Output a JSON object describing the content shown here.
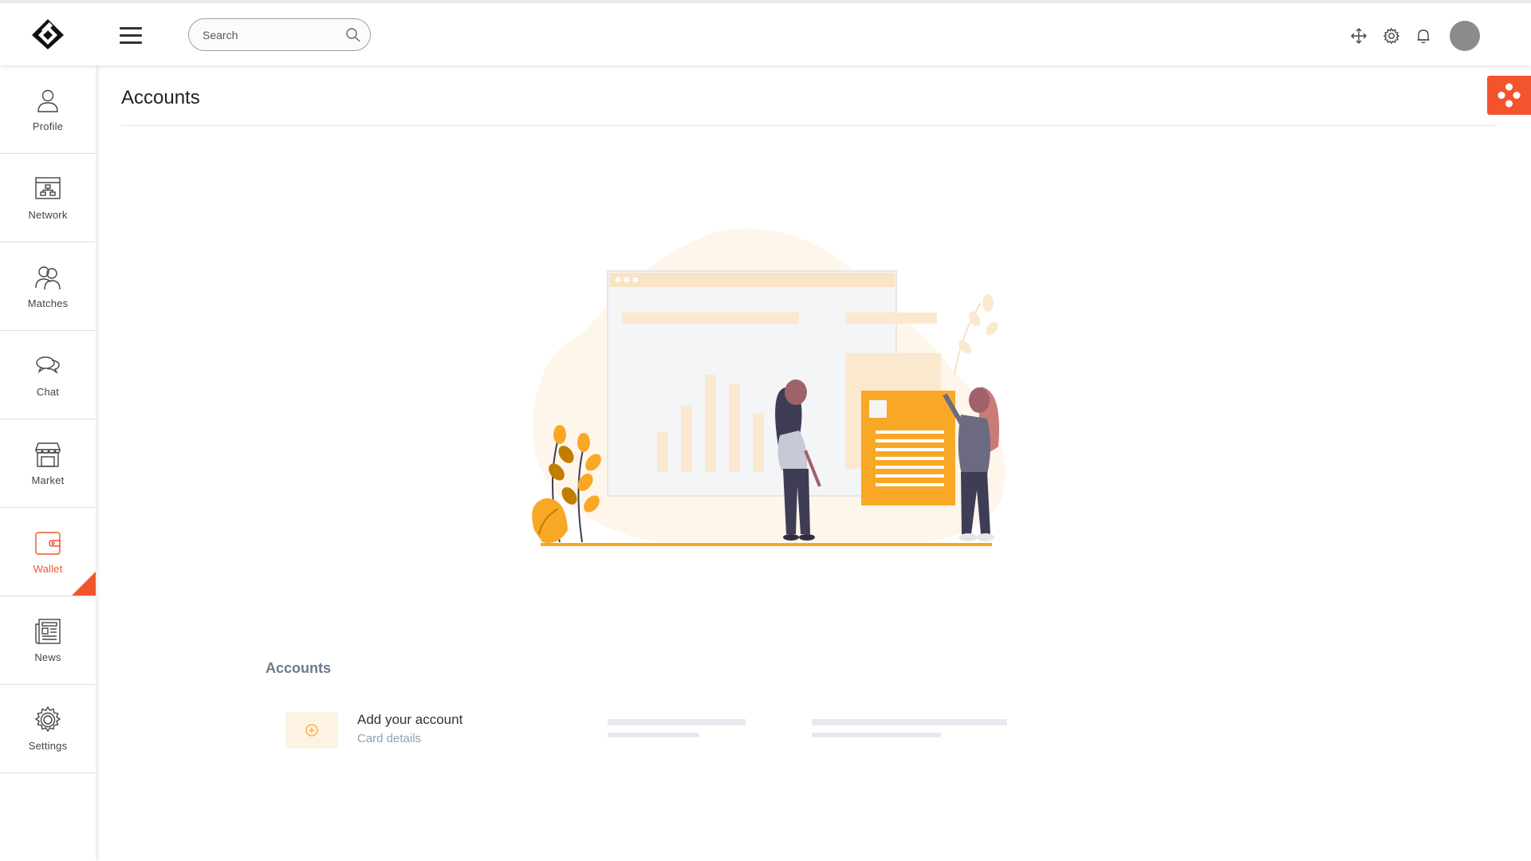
{
  "header": {
    "search": {
      "placeholder": "Search"
    }
  },
  "sidebar": {
    "items": [
      {
        "label": "Profile",
        "icon": "profile-icon"
      },
      {
        "label": "Network",
        "icon": "network-icon"
      },
      {
        "label": "Matches",
        "icon": "matches-icon"
      },
      {
        "label": "Chat",
        "icon": "chat-icon"
      },
      {
        "label": "Market",
        "icon": "market-icon"
      },
      {
        "label": "Wallet",
        "icon": "wallet-icon",
        "active": true
      },
      {
        "label": "News",
        "icon": "news-icon"
      },
      {
        "label": "Settings",
        "icon": "settings-icon"
      }
    ]
  },
  "main": {
    "title": "Accounts",
    "section_title": "Accounts",
    "add_account": {
      "title": "Add your account",
      "subtitle": "Card details"
    }
  },
  "colors": {
    "accent": "#f2542d",
    "illustration_orange": "#f9a826",
    "illustration_cream": "#fdf1de",
    "muted_blue": "#8aa0b8"
  }
}
